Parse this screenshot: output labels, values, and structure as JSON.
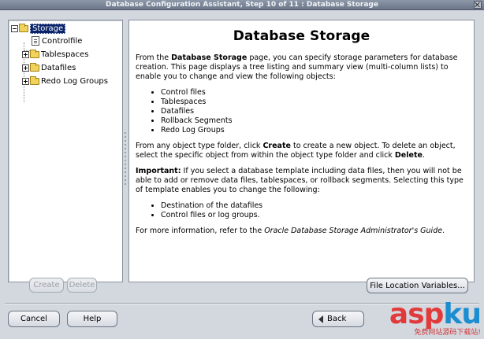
{
  "window": {
    "title": "Database Configuration Assistant, Step 10 of 11 : Database Storage"
  },
  "tree": {
    "root": "Storage",
    "items": [
      {
        "label": "Controlfile"
      },
      {
        "label": "Tablespaces"
      },
      {
        "label": "Datafiles"
      },
      {
        "label": "Redo Log Groups"
      }
    ]
  },
  "content": {
    "heading": "Database Storage",
    "intro": [
      "From the ",
      "Database Storage",
      " page, you can specify storage parameters for database creation. This page displays a tree listing and summary view (multi-column lists) to enable you to change and view the following objects:"
    ],
    "objects": [
      "Control files",
      "Tablespaces",
      "Datafiles",
      "Rollback Segments",
      "Redo Log Groups"
    ],
    "create_delete": [
      "From any object type folder, click ",
      "Create",
      " to create a new object. To delete an object, select the specific object from within the object type folder and click ",
      "Delete",
      "."
    ],
    "important_label": "Important:",
    "important_text": " If you select a database template including data files, then you will not be able to add or remove data files, tablespaces, or rollback segments. Selecting this type of template enables you to change the following:",
    "changes": [
      "Destination of the datafiles",
      "Control files or log groups."
    ],
    "more_info": [
      "For more information, refer to the ",
      "Oracle Database Storage Administrator's Guide",
      "."
    ]
  },
  "buttons": {
    "create": "Create",
    "delete": "Delete",
    "file_location": "File Location Variables...",
    "cancel": "Cancel",
    "help": "Help",
    "back": "Back"
  },
  "watermark": {
    "asp": "asp",
    "ku": "ku",
    "sub": "免费网站源码下载站!"
  }
}
